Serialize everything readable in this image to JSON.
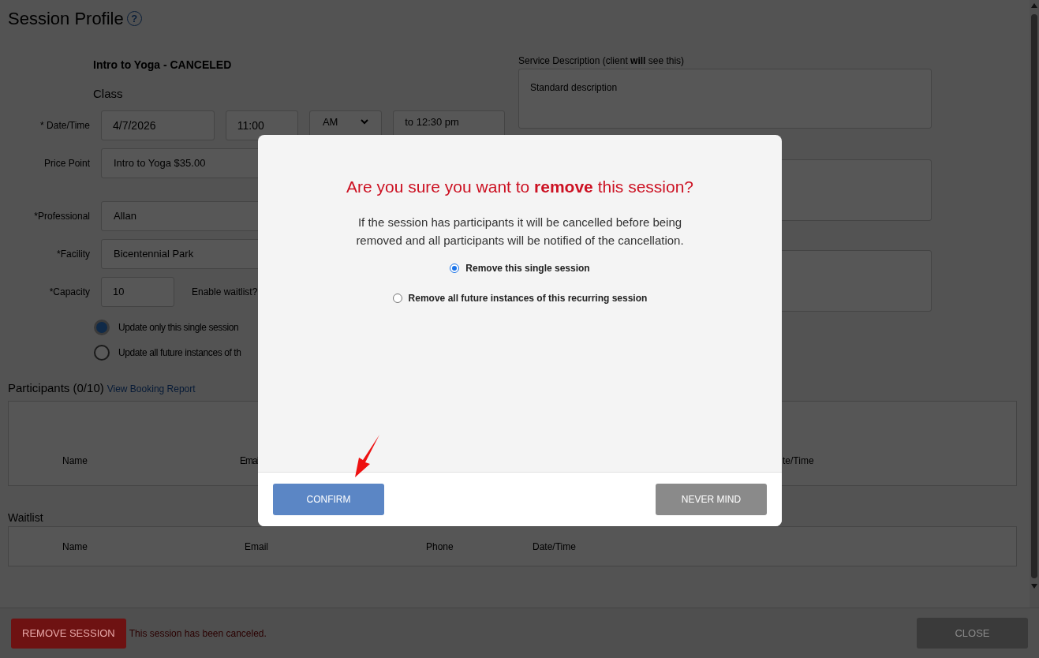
{
  "page": {
    "title": "Session Profile",
    "help_icon": "?"
  },
  "session": {
    "name": "Intro to Yoga - CANCELED",
    "type": "Class"
  },
  "date_time": {
    "label": "* Date/Time",
    "date": "4/7/2026",
    "time": "11:00",
    "meridiem": "AM",
    "end": "to 12:30 pm"
  },
  "price_point": {
    "label": "Price Point",
    "value": "Intro to Yoga $35.00"
  },
  "professional": {
    "label": "*Professional",
    "value": "Allan"
  },
  "facility": {
    "label": "*Facility",
    "value": "Bicentennial Park"
  },
  "capacity": {
    "label": "*Capacity",
    "value": "10",
    "waitlist_label": "Enable waitlist?"
  },
  "update_scope": [
    {
      "label": "Update only this single session",
      "selected": true
    },
    {
      "label": "Update all future instances of th",
      "selected": false
    }
  ],
  "service_description": {
    "label": "Service Description (client **will** see this)",
    "value": "Standard description"
  },
  "participants": {
    "title": "Participants (0/10)",
    "link": "View Booking Report",
    "columns": [
      "Name",
      "Emai",
      "te/Time"
    ]
  },
  "waitlist": {
    "title": "Waitlist",
    "columns": [
      "Name",
      "Email",
      "Phone",
      "Date/Time"
    ]
  },
  "footer": {
    "remove_button": "REMOVE SESSION",
    "status": "This session has been canceled.",
    "close_button": "CLOSE"
  },
  "dialog": {
    "title": "Are you sure you want to **remove** this session?",
    "message": "If the session has participants it will be cancelled before being removed and all participants will be notified of the cancellation.",
    "options": [
      {
        "label": "Remove this single session",
        "selected": true
      },
      {
        "label": "Remove all future instances of this recurring session",
        "selected": false
      }
    ],
    "confirm_button": "CONFIRM",
    "cancel_button": "NEVER MIND"
  }
}
